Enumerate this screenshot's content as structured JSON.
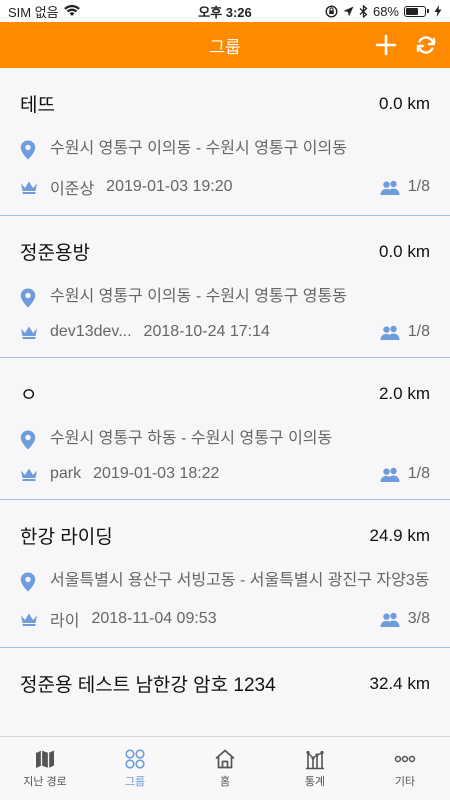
{
  "status_bar": {
    "carrier": "SIM 없음",
    "time": "오후 3:26",
    "battery": "68%"
  },
  "header": {
    "title": "그룹"
  },
  "groups": [
    {
      "name": "테뜨",
      "distance": "0.0 km",
      "route": "수원시 영통구 이의동 - 수원시 영통구 이의동",
      "owner": "이준상",
      "date": "2019-01-03 19:20",
      "members": "1/8"
    },
    {
      "name": "정준용방",
      "distance": "0.0 km",
      "route": "수원시 영통구 이의동 - 수원시 영통구 영통동",
      "owner": "dev13dev...",
      "date": "2018-10-24 17:14",
      "members": "1/8"
    },
    {
      "name": "ㅇ",
      "distance": "2.0 km",
      "route": "수원시 영통구 하동 - 수원시 영통구 이의동",
      "owner": "park",
      "date": "2019-01-03 18:22",
      "members": "1/8"
    },
    {
      "name": "한강 라이딩",
      "distance": "24.9 km",
      "route": "서울특별시 용산구 서빙고동 - 서울특별시 광진구 자양3동",
      "owner": "라이",
      "date": "2018-11-04 09:53",
      "members": "3/8"
    },
    {
      "name": "정준용 테스트 남한강 암호 1234",
      "distance": "32.4 km"
    }
  ],
  "tabs": [
    {
      "label": "지난 경로",
      "icon": "map-icon"
    },
    {
      "label": "그룹",
      "icon": "group-icon",
      "active": true
    },
    {
      "label": "홈",
      "icon": "home-icon"
    },
    {
      "label": "통계",
      "icon": "stats-icon"
    },
    {
      "label": "기타",
      "icon": "more-icon"
    }
  ],
  "colors": {
    "header": "#ff8a00",
    "accent": "#6f9cdc",
    "divider": "#9fc2ea"
  }
}
